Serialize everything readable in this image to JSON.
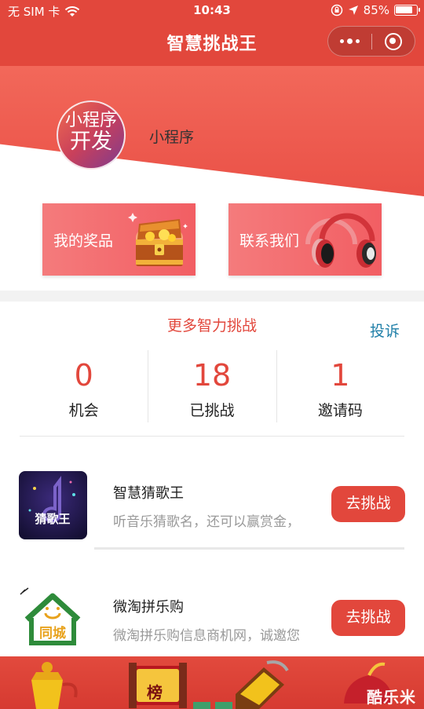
{
  "status_bar": {
    "carrier": "无 SIM 卡",
    "time": "10:43",
    "battery_percent": "85%",
    "battery_level": 0.85,
    "icons": [
      "wifi-icon",
      "rotation-lock-icon",
      "location-arrow-icon",
      "battery-icon"
    ]
  },
  "nav": {
    "title": "智慧挑战王",
    "menu_icon": "more-dots-icon",
    "close_icon": "target-circle-icon"
  },
  "profile": {
    "avatar_line1": "小程序",
    "avatar_line2": "开发",
    "nickname": "小程序"
  },
  "cards": {
    "prizes_label": "我的奖品",
    "contact_label": "联系我们"
  },
  "section": {
    "title": "更多智力挑战",
    "complain": "投诉"
  },
  "stats": [
    {
      "value": "0",
      "label": "机会"
    },
    {
      "value": "18",
      "label": "已挑战"
    },
    {
      "value": "1",
      "label": "邀请码"
    }
  ],
  "games": [
    {
      "name": "智慧猜歌王",
      "desc": "听音乐猜歌名，还可以赢赏金，",
      "button": "去挑战",
      "icon_text": "猜歌王"
    },
    {
      "name": "微淘拼乐购",
      "desc": "微淘拼乐购信息商机网，诚邀您",
      "button": "去挑战",
      "icon_text": "同城"
    }
  ],
  "banner": {
    "plaque_text": "榜",
    "watermark": "酷乐米"
  },
  "colors": {
    "brand_red": "#e2473c",
    "link_blue": "#1f7fa8",
    "muted_text": "#999999"
  }
}
